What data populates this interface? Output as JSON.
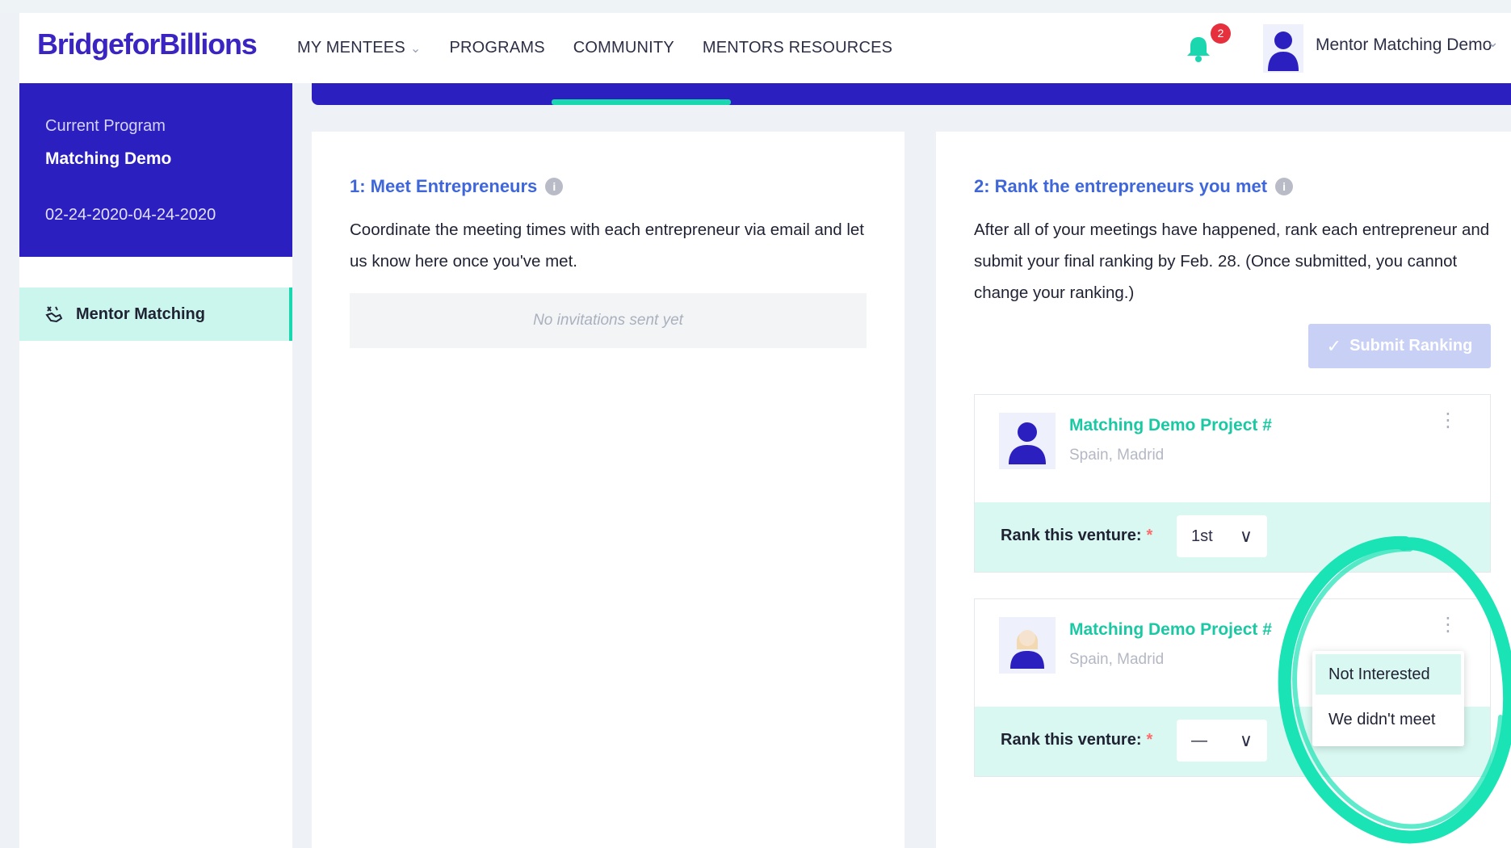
{
  "brand": {
    "logo_text": "BridgeforBillions",
    "logo_color": "#3a24c2"
  },
  "nav": {
    "items": [
      {
        "label": "MY MENTEES",
        "has_dropdown": true
      },
      {
        "label": "PROGRAMS"
      },
      {
        "label": "COMMUNITY"
      },
      {
        "label": "MENTORS RESOURCES"
      }
    ]
  },
  "header": {
    "notification_count": "2",
    "user_name": "Mentor Matching Demo"
  },
  "sidebar": {
    "program_label": "Current Program",
    "program_name": "Matching Demo",
    "program_dates": "02-24-2020-04-24-2020",
    "items": [
      {
        "label": "Mentor Matching",
        "icon": "handshake-icon",
        "active": true
      }
    ]
  },
  "step1": {
    "title": "1: Meet Entrepreneurs",
    "description": "Coordinate the meeting times with each entrepreneur via email and let us know here once you've met.",
    "empty_text": "No invitations sent yet"
  },
  "step2": {
    "title": "2: Rank the entrepreneurs you met",
    "description": "After all of your meetings have happened, rank each entrepreneur and submit your final ranking by Feb. 28. (Once submitted, you cannot change your ranking.)",
    "submit_label": "Submit Ranking",
    "rank_label": "Rank this venture:",
    "required_mark": "*"
  },
  "ventures": [
    {
      "name": "Matching Demo Project #",
      "location": "Spain, Madrid",
      "rank_value": "1st"
    },
    {
      "name": "Matching Demo Project #",
      "location": "Spain, Madrid",
      "rank_value": "—"
    }
  ],
  "dropdown": {
    "options": [
      "Not Interested",
      "We didn't meet"
    ],
    "highlighted": "Not Interested"
  },
  "colors": {
    "primary": "#2b1fbf",
    "accent": "#1ad7b0",
    "link": "#3f67d9",
    "notification": "#e6303d"
  }
}
